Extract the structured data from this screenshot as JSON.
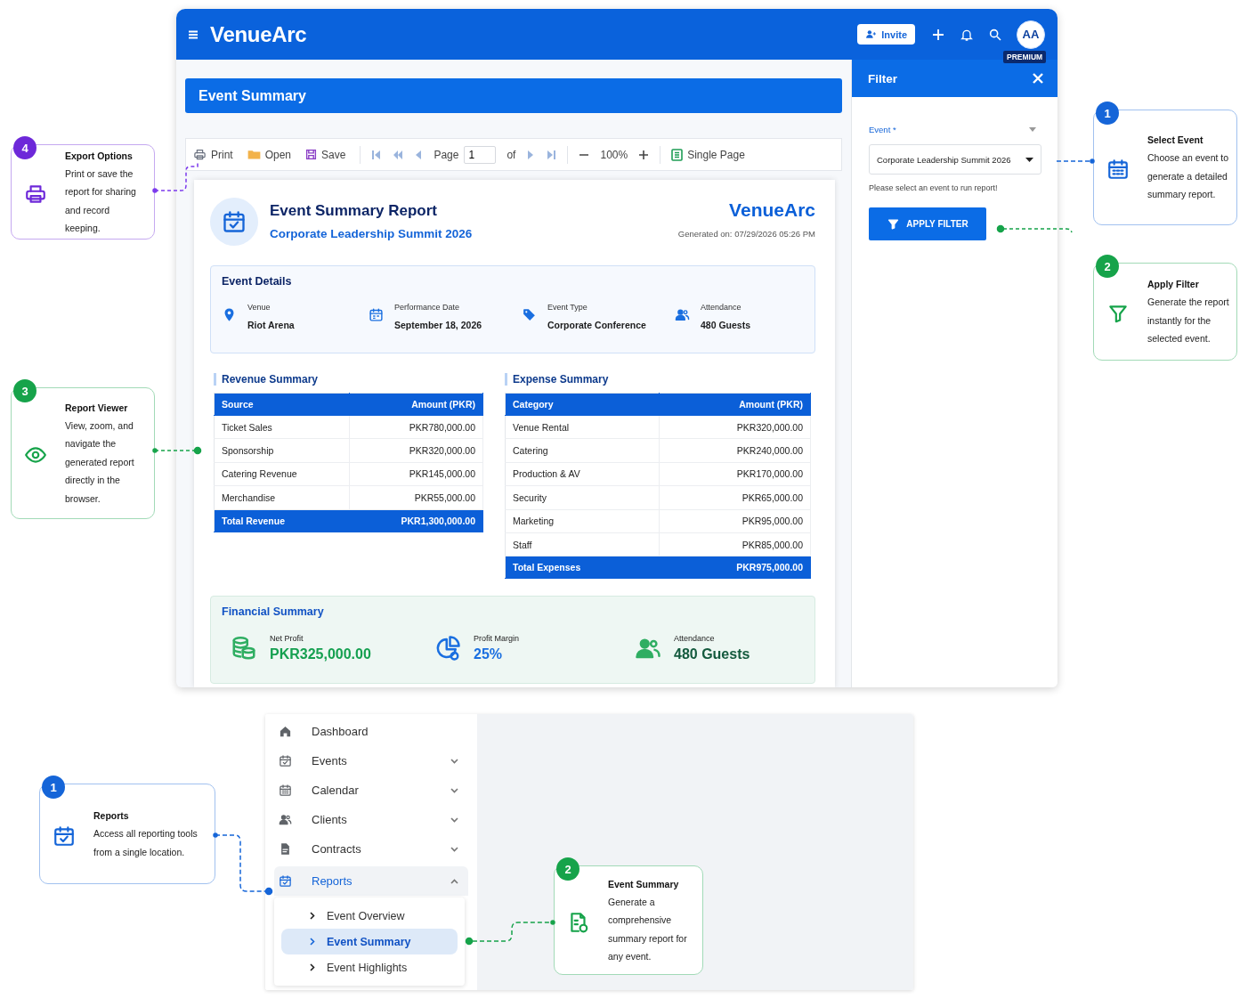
{
  "app": {
    "brand": "VenueArc",
    "invite": "Invite",
    "avatar": "AA",
    "badge": "PREMIUM"
  },
  "page_title": "Event Summary",
  "toolbar": {
    "print": "Print",
    "open": "Open",
    "save": "Save",
    "page_label": "Page",
    "page": "1",
    "of": "of",
    "zoom": "100%",
    "view": "Single Page"
  },
  "report": {
    "title": "Event Summary Report",
    "event": "Corporate Leadership Summit 2026",
    "brand": "VenueArc",
    "generated": "Generated on: 07/29/2026 05:26 PM",
    "details": {
      "title": "Event Details",
      "items": [
        {
          "label": "Venue",
          "value": "Riot Arena"
        },
        {
          "label": "Performance Date",
          "value": "September 18, 2026"
        },
        {
          "label": "Event Type",
          "value": "Corporate Conference"
        },
        {
          "label": "Attendance",
          "value": "480 Guests"
        }
      ]
    },
    "revenue": {
      "title": "Revenue Summary",
      "columns": [
        "Source",
        "Amount (PKR)"
      ],
      "rows": [
        [
          "Ticket Sales",
          "PKR780,000.00"
        ],
        [
          "Sponsorship",
          "PKR320,000.00"
        ],
        [
          "Catering Revenue",
          "PKR145,000.00"
        ],
        [
          "Merchandise",
          "PKR55,000.00"
        ]
      ],
      "total": [
        "Total Revenue",
        "PKR1,300,000.00"
      ]
    },
    "expenses": {
      "title": "Expense Summary",
      "columns": [
        "Category",
        "Amount (PKR)"
      ],
      "rows": [
        [
          "Venue Rental",
          "PKR320,000.00"
        ],
        [
          "Catering",
          "PKR240,000.00"
        ],
        [
          "Production & AV",
          "PKR170,000.00"
        ],
        [
          "Security",
          "PKR65,000.00"
        ],
        [
          "Marketing",
          "PKR95,000.00"
        ],
        [
          "Staff",
          "PKR85,000.00"
        ]
      ],
      "total": [
        "Total Expenses",
        "PKR975,000.00"
      ]
    },
    "financial": {
      "title": "Financial Summary",
      "items": [
        {
          "label": "Net Profit",
          "value": "PKR325,000.00"
        },
        {
          "label": "Profit Margin",
          "value": "25%"
        },
        {
          "label": "Attendance",
          "value": "480 Guests"
        }
      ]
    }
  },
  "filter": {
    "title": "Filter",
    "label": "Event *",
    "value": "Corporate Leadership Summit 2026",
    "hint": "Please select an event to run report!",
    "button": "APPLY FILTER"
  },
  "callouts": [
    {
      "number": "4",
      "title": "Export Options",
      "text": "Print or save the report for sharing and record keeping.",
      "color": "#6d28d9"
    },
    {
      "number": "3",
      "title": "Report Viewer",
      "text": "View, zoom, and navigate the generated report directly in the browser.",
      "color": "#16a34a"
    },
    {
      "number": "1",
      "title": "Select Event",
      "text": "Choose an event to generate a detailed summary report.",
      "color": "#1565d8"
    },
    {
      "number": "2",
      "title": "Apply Filter",
      "text": "Generate the report instantly for the selected event.",
      "color": "#16a34a"
    }
  ],
  "sidebar": {
    "items": [
      {
        "label": "Dashboard",
        "selected": false
      },
      {
        "label": "Events",
        "selected": false,
        "expanded": false
      },
      {
        "label": "Calendar",
        "selected": false,
        "expanded": false
      },
      {
        "label": "Clients",
        "selected": false,
        "expanded": false
      },
      {
        "label": "Contracts",
        "selected": false,
        "expanded": false
      },
      {
        "label": "Reports",
        "selected": true,
        "expanded": true,
        "children": [
          {
            "label": "Event Overview",
            "selected": false
          },
          {
            "label": "Event Summary",
            "selected": true
          },
          {
            "label": "Event Highlights",
            "selected": false
          }
        ]
      }
    ]
  },
  "menu_callouts": [
    {
      "number": "1",
      "title": "Reports",
      "text": "Access all reporting tools from a single location.",
      "color": "#1565d8"
    },
    {
      "number": "2",
      "title": "Event Summary",
      "text": "Generate a comprehensive summary report for any event.",
      "color": "#16a34a"
    }
  ]
}
